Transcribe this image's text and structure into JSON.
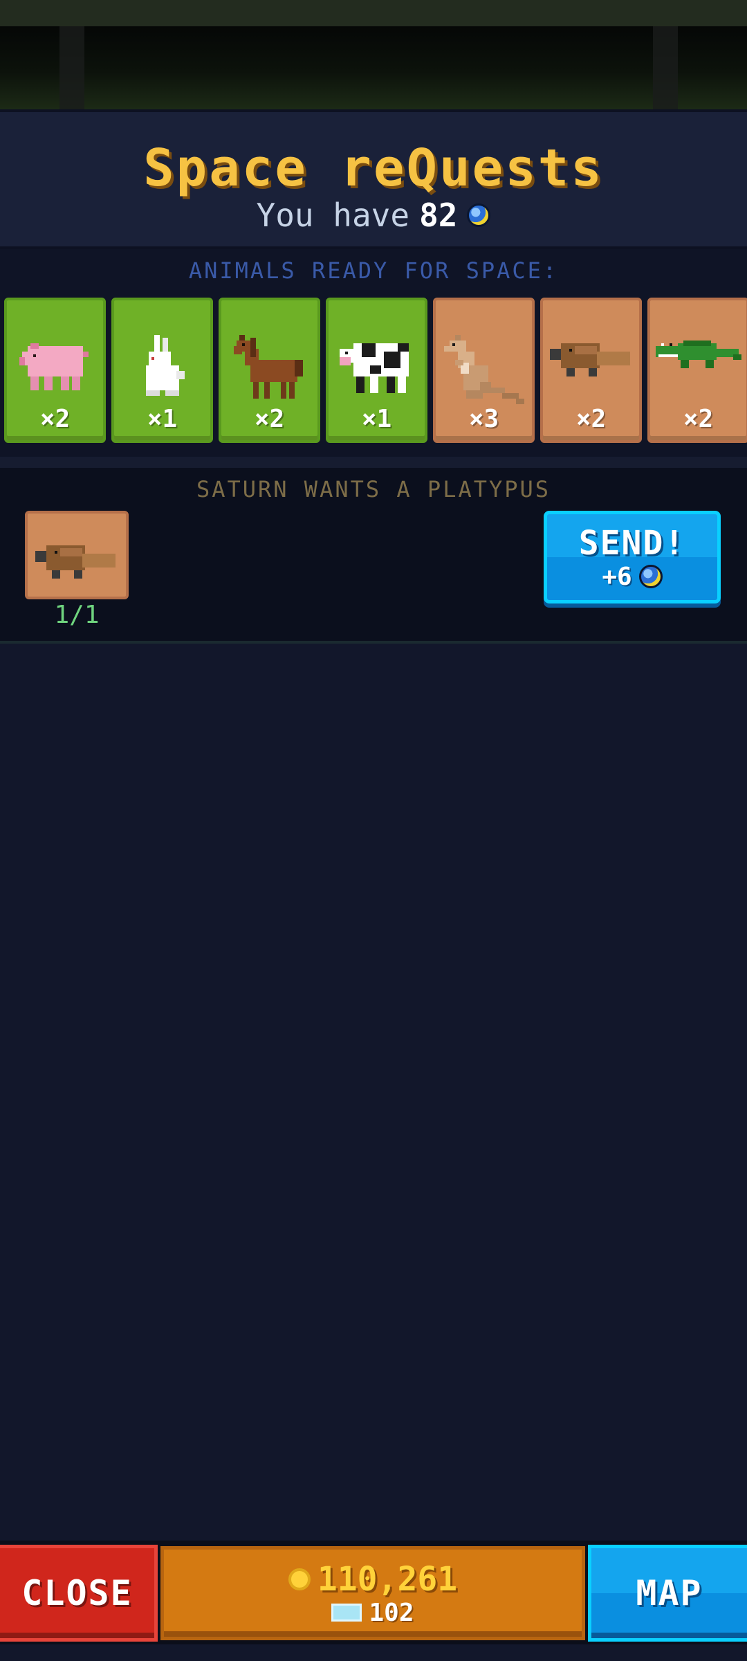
{
  "header": {
    "title": "Space reQuests",
    "subtitle_prefix": "You have",
    "space_coins": "82"
  },
  "animals_section": {
    "label": "ANIMALS READY FOR SPACE:",
    "cards": [
      {
        "animal": "pig",
        "count": "×2",
        "bg": "green"
      },
      {
        "animal": "rabbit",
        "count": "×1",
        "bg": "green"
      },
      {
        "animal": "horse",
        "count": "×2",
        "bg": "green"
      },
      {
        "animal": "cow",
        "count": "×1",
        "bg": "green"
      },
      {
        "animal": "kangaroo",
        "count": "×3",
        "bg": "tan"
      },
      {
        "animal": "platypus",
        "count": "×2",
        "bg": "tan"
      },
      {
        "animal": "crocodile",
        "count": "×2",
        "bg": "tan"
      }
    ]
  },
  "request": {
    "label": "SATURN WANTS A PLATYPUS",
    "animal": "platypus",
    "progress": "1/1",
    "send_label": "SEND!",
    "reward": "+6"
  },
  "bottom_bar": {
    "close_label": "CLOSE",
    "coins": "110,261",
    "gems": "102",
    "map_label": "MAP"
  },
  "colors": {
    "title": "#f6c243",
    "green_card": "#6fb127",
    "tan_card": "#cf8b5b",
    "send_button": "#14a5ee",
    "close_button": "#d0261c",
    "currency_bar": "#d47a12"
  }
}
